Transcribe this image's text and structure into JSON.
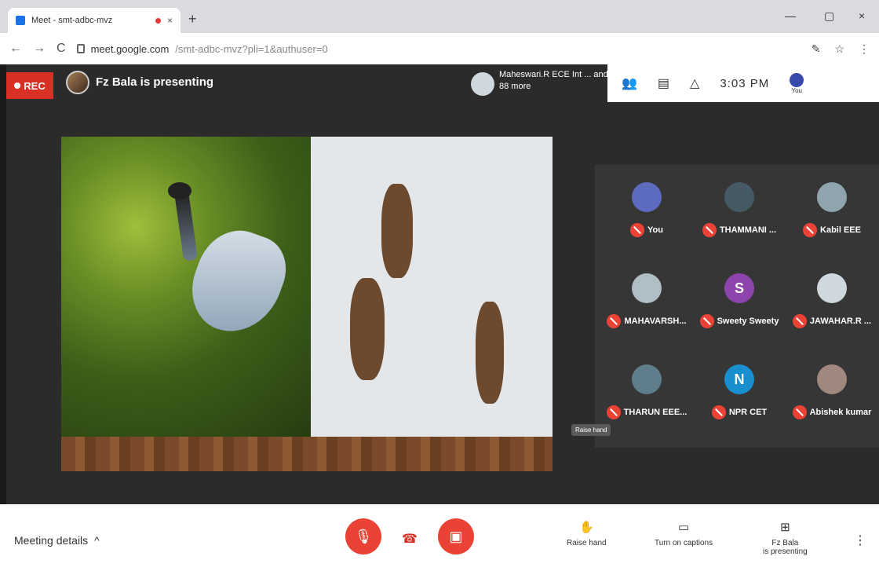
{
  "browser": {
    "tab_title": "Meet - smt-adbc-mvz",
    "tab_close": "×",
    "new_tab": "+",
    "win_min": "—",
    "win_max": "▢",
    "win_close": "×",
    "url_host": "meet.google.com",
    "url_path": "/smt-adbc-mvz?pli=1&authuser=0",
    "back": "←",
    "forward": "→",
    "reload": "C",
    "ext_icons": [
      "✎",
      "☆",
      "⋮"
    ]
  },
  "meet": {
    "rec_label": "REC",
    "presenting_text": "Fz Bala is presenting",
    "others_text": "Maheswari.R ECE Int ... and 88 more",
    "clock": "3:03 PM",
    "you_label": "You",
    "tooltip": "Raise hand",
    "participants": [
      {
        "name": "You",
        "initial": "",
        "color": "#5c6bc0"
      },
      {
        "name": "THAMMANI ...",
        "initial": "",
        "color": "#455a64"
      },
      {
        "name": "Kabil EEE",
        "initial": "",
        "color": "#90a4ae"
      },
      {
        "name": "MAHAVARSH...",
        "initial": "",
        "color": "#b0bec5"
      },
      {
        "name": "Sweety Sweety",
        "initial": "S",
        "color": "#8e44ad"
      },
      {
        "name": "JAWAHAR.R ...",
        "initial": "",
        "color": "#cfd8dc"
      },
      {
        "name": "THARUN EEE...",
        "initial": "",
        "color": "#607d8b"
      },
      {
        "name": "NPR CET",
        "initial": "N",
        "color": "#1a8fcf"
      },
      {
        "name": "Abishek kumar",
        "initial": "",
        "color": "#a1887f"
      }
    ]
  },
  "bottom": {
    "meeting_details": "Meeting details",
    "chevron": "^",
    "raise_hand": "Raise hand",
    "captions": "Turn on captions",
    "presenting_line1": "Fz Bala",
    "presenting_line2": "is presenting",
    "more": "⋮"
  },
  "colors": {
    "danger": "#ea4335",
    "rec": "#d93025"
  }
}
